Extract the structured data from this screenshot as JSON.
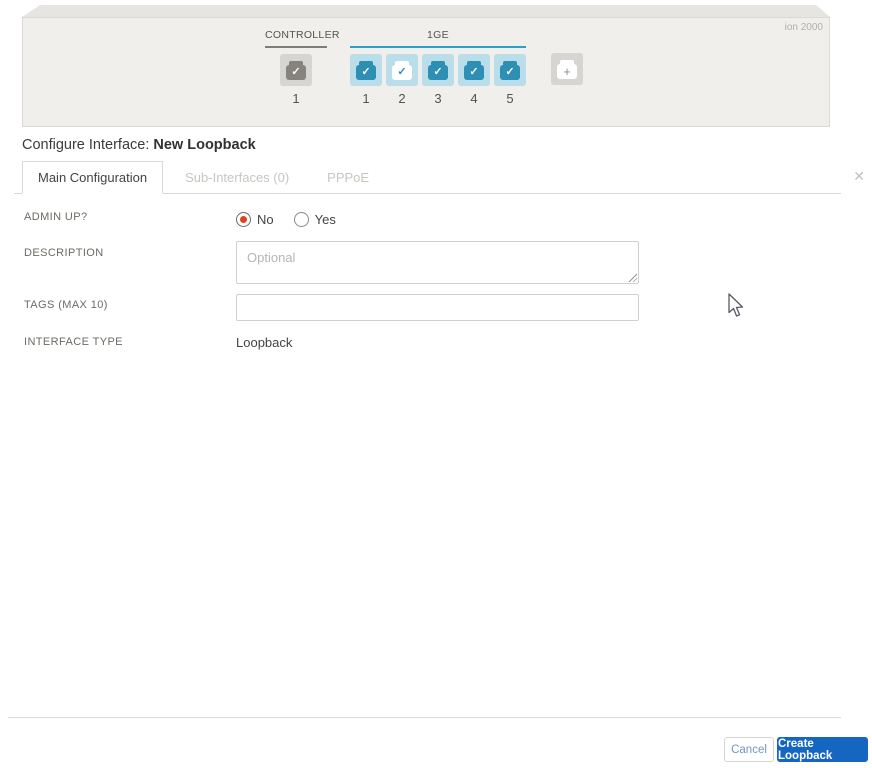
{
  "icons": {
    "check": "✓",
    "add": "+",
    "close": "✕"
  },
  "device": {
    "model_label": "ion 2000",
    "controller_group": {
      "label": "CONTROLLER",
      "ports": [
        {
          "number": "1",
          "state": "checked-gray"
        }
      ]
    },
    "ge_group": {
      "label": "1GE",
      "ports": [
        {
          "number": "1",
          "state": "checked-solid"
        },
        {
          "number": "2",
          "state": "checked-selected"
        },
        {
          "number": "3",
          "state": "checked-solid"
        },
        {
          "number": "4",
          "state": "checked-solid"
        },
        {
          "number": "5",
          "state": "checked-solid"
        }
      ]
    },
    "add_port": {
      "state": "available"
    }
  },
  "header": {
    "title_prefix": "Configure Interface: ",
    "title_name": "New Loopback"
  },
  "tabs": [
    {
      "label": "Main Configuration",
      "active": true
    },
    {
      "label": "Sub-Interfaces (0)",
      "active": false
    },
    {
      "label": "PPPoE",
      "active": false
    }
  ],
  "form": {
    "admin_up": {
      "label": "ADMIN UP?",
      "options": [
        {
          "label": "No",
          "selected": true
        },
        {
          "label": "Yes",
          "selected": false
        }
      ]
    },
    "description": {
      "label": "DESCRIPTION",
      "placeholder": "Optional",
      "value": ""
    },
    "tags": {
      "label": "TAGS (MAX 10)",
      "value": ""
    },
    "interface_type": {
      "label": "INTERFACE TYPE",
      "value": "Loopback"
    }
  },
  "footer": {
    "cancel_label": "Cancel",
    "submit_label": "Create Loopback"
  },
  "colors": {
    "port_tile_blue": "#b9dde9",
    "port_icon_teal": "#2d8fb3",
    "ge_underline_blue": "#2ba1c9",
    "radio_selected_red": "#e3401f",
    "primary_button_blue": "#1566c1",
    "cancel_text_blue": "#7195c4",
    "chassis_face": "#f0efec"
  }
}
